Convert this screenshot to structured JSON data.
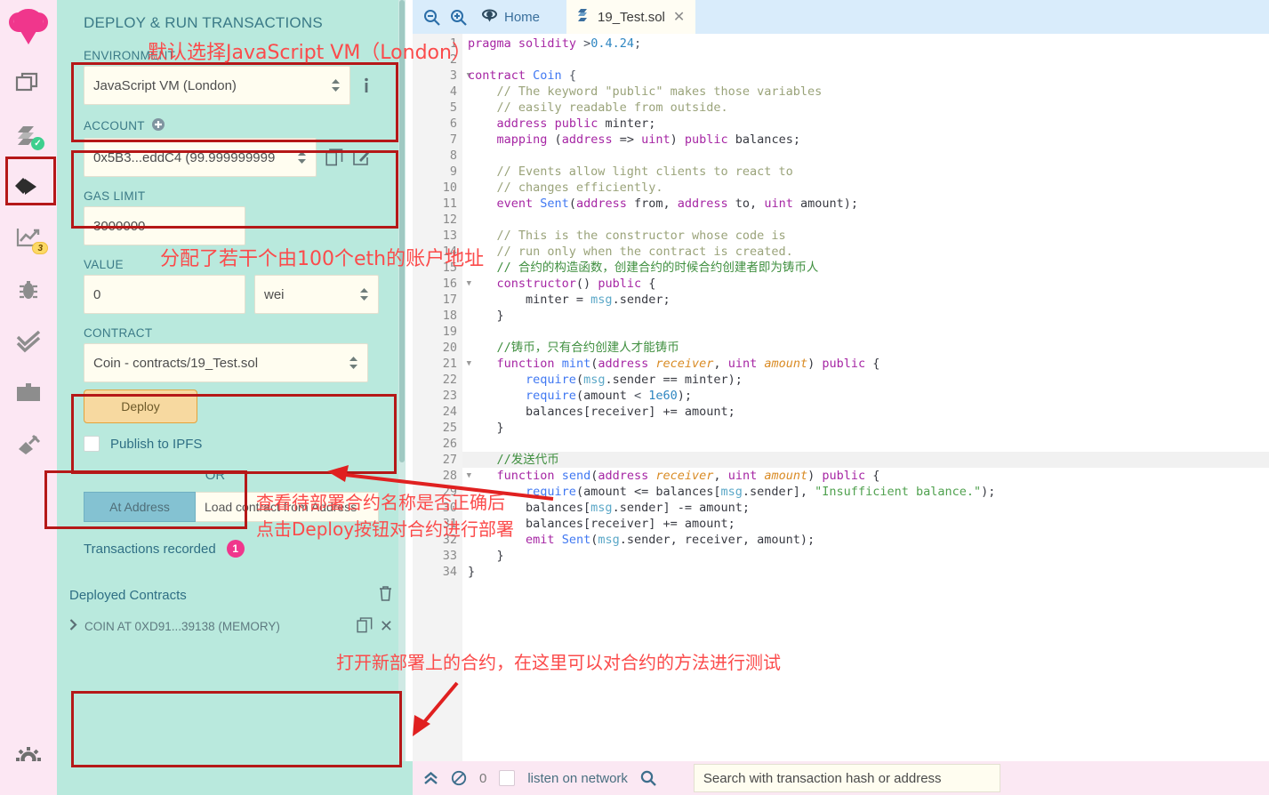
{
  "iconbar": {
    "items": [
      {
        "name": "remix-logo",
        "label": "Remix"
      },
      {
        "name": "file-explorer",
        "label": "File explorers"
      },
      {
        "name": "solidity-compiler",
        "label": "Solidity compiler",
        "status": "compiled"
      },
      {
        "name": "deploy-run-transactions",
        "label": "Deploy & run transactions",
        "selected": true
      },
      {
        "name": "solidity-analyzers",
        "label": "Solidity analyzers",
        "badge": "3"
      },
      {
        "name": "debugger",
        "label": "Debugger"
      },
      {
        "name": "solidity-unit-testing",
        "label": "Solidity unit testing"
      },
      {
        "name": "documentation",
        "label": "Documentation"
      },
      {
        "name": "plugin-manager",
        "label": "Plugin manager"
      },
      {
        "name": "settings",
        "label": "Settings"
      }
    ]
  },
  "panel": {
    "title": "DEPLOY & RUN TRANSACTIONS",
    "environment": {
      "label": "ENVIRONMENT",
      "value": "JavaScript VM (London)"
    },
    "account": {
      "label": "ACCOUNT",
      "value": "0x5B3...eddC4 (99.999999999"
    },
    "gas_limit": {
      "label": "GAS LIMIT",
      "value": "3000000"
    },
    "value": {
      "label": "VALUE",
      "value": "0",
      "unit": "wei"
    },
    "contract": {
      "label": "CONTRACT",
      "value": "Coin - contracts/19_Test.sol"
    },
    "deploy_button": "Deploy",
    "publish_ipfs": "Publish to IPFS",
    "or": "OR",
    "at_address_button": "At Address",
    "at_address_placeholder": "Load contract from Address",
    "transactions_recorded": {
      "label": "Transactions recorded",
      "count": "1"
    },
    "deployed_contracts": {
      "title": "Deployed Contracts",
      "items": [
        "COIN AT 0XD91...39138 (MEMORY)"
      ]
    }
  },
  "annotations": [
    "默认选择JavaScript VM（London）",
    "分配了若干个由100个eth的账户地址",
    "查看待部署合约名称是否正确后",
    "点击Deploy按钮对合约进行部署",
    "打开新部署上的合约，在这里可以对合约的方法进行测试"
  ],
  "editor": {
    "tabs": [
      {
        "name": "home",
        "label": "Home"
      },
      {
        "name": "file",
        "label": "19_Test.sol",
        "active": true
      }
    ],
    "highlight_line": 27,
    "lines": [
      {
        "n": 1,
        "fold": false,
        "tokens": [
          [
            "kw",
            "pragma"
          ],
          [
            "id",
            " "
          ],
          [
            "kw",
            "solidity"
          ],
          [
            "id",
            " "
          ],
          [
            "op",
            ">"
          ],
          [
            "nu",
            "0.4.24"
          ],
          [
            "op",
            ";"
          ]
        ]
      },
      {
        "n": 2,
        "fold": false,
        "tokens": [
          [
            "id",
            ""
          ]
        ]
      },
      {
        "n": 3,
        "fold": true,
        "tokens": [
          [
            "kw",
            "contract"
          ],
          [
            "id",
            " "
          ],
          [
            "fn",
            "Coin"
          ],
          [
            "id",
            " "
          ],
          [
            "op",
            "{"
          ]
        ]
      },
      {
        "n": 4,
        "fold": false,
        "tokens": [
          [
            "cm",
            "    // The keyword \"public\" makes those variables"
          ]
        ]
      },
      {
        "n": 5,
        "fold": false,
        "tokens": [
          [
            "cm",
            "    // easily readable from outside."
          ]
        ]
      },
      {
        "n": 6,
        "fold": false,
        "tokens": [
          [
            "id",
            "    "
          ],
          [
            "kw",
            "address"
          ],
          [
            "id",
            " "
          ],
          [
            "kw",
            "public"
          ],
          [
            "id",
            " minter;"
          ]
        ]
      },
      {
        "n": 7,
        "fold": false,
        "tokens": [
          [
            "id",
            "    "
          ],
          [
            "kw",
            "mapping"
          ],
          [
            "id",
            " ("
          ],
          [
            "kw",
            "address"
          ],
          [
            "id",
            " => "
          ],
          [
            "kw",
            "uint"
          ],
          [
            "id",
            ") "
          ],
          [
            "kw",
            "public"
          ],
          [
            "id",
            " balances;"
          ]
        ]
      },
      {
        "n": 8,
        "fold": false,
        "tokens": [
          [
            "id",
            ""
          ]
        ]
      },
      {
        "n": 9,
        "fold": false,
        "tokens": [
          [
            "cm",
            "    // Events allow light clients to react to"
          ]
        ]
      },
      {
        "n": 10,
        "fold": false,
        "tokens": [
          [
            "cm",
            "    // changes efficiently."
          ]
        ]
      },
      {
        "n": 11,
        "fold": false,
        "tokens": [
          [
            "id",
            "    "
          ],
          [
            "kw",
            "event"
          ],
          [
            "id",
            " "
          ],
          [
            "fn",
            "Sent"
          ],
          [
            "id",
            "("
          ],
          [
            "kw",
            "address"
          ],
          [
            "id",
            " from, "
          ],
          [
            "kw",
            "address"
          ],
          [
            "id",
            " to, "
          ],
          [
            "kw",
            "uint"
          ],
          [
            "id",
            " amount);"
          ]
        ]
      },
      {
        "n": 12,
        "fold": false,
        "tokens": [
          [
            "id",
            ""
          ]
        ]
      },
      {
        "n": 13,
        "fold": false,
        "tokens": [
          [
            "cm",
            "    // This is the constructor whose code is"
          ]
        ]
      },
      {
        "n": 14,
        "fold": false,
        "tokens": [
          [
            "cm",
            "    // run only when the contract is created."
          ]
        ]
      },
      {
        "n": 15,
        "fold": false,
        "tokens": [
          [
            "cmg",
            "    // 合约的构造函数，创建合约的时候合约创建者即为铸币人"
          ]
        ]
      },
      {
        "n": 16,
        "fold": true,
        "tokens": [
          [
            "id",
            "    "
          ],
          [
            "kw",
            "constructor"
          ],
          [
            "id",
            "() "
          ],
          [
            "kw",
            "public"
          ],
          [
            "id",
            " {"
          ]
        ]
      },
      {
        "n": 17,
        "fold": false,
        "tokens": [
          [
            "id",
            "        minter = "
          ],
          [
            "obj",
            "msg"
          ],
          [
            "id",
            ".sender;"
          ]
        ]
      },
      {
        "n": 18,
        "fold": false,
        "tokens": [
          [
            "id",
            "    }"
          ]
        ]
      },
      {
        "n": 19,
        "fold": false,
        "tokens": [
          [
            "id",
            ""
          ]
        ]
      },
      {
        "n": 20,
        "fold": false,
        "tokens": [
          [
            "cmg",
            "    //铸币，只有合约创建人才能铸币"
          ]
        ]
      },
      {
        "n": 21,
        "fold": true,
        "tokens": [
          [
            "id",
            "    "
          ],
          [
            "kw",
            "function"
          ],
          [
            "id",
            " "
          ],
          [
            "fn",
            "mint"
          ],
          [
            "id",
            "("
          ],
          [
            "kw",
            "address"
          ],
          [
            "id",
            " "
          ],
          [
            "par",
            "receiver"
          ],
          [
            "id",
            ", "
          ],
          [
            "kw",
            "uint"
          ],
          [
            "id",
            " "
          ],
          [
            "par",
            "amount"
          ],
          [
            "id",
            ") "
          ],
          [
            "kw",
            "public"
          ],
          [
            "id",
            " {"
          ]
        ]
      },
      {
        "n": 22,
        "fold": false,
        "tokens": [
          [
            "id",
            "        "
          ],
          [
            "fn",
            "require"
          ],
          [
            "id",
            "("
          ],
          [
            "obj",
            "msg"
          ],
          [
            "id",
            ".sender == minter);"
          ]
        ]
      },
      {
        "n": 23,
        "fold": false,
        "tokens": [
          [
            "id",
            "        "
          ],
          [
            "fn",
            "require"
          ],
          [
            "id",
            "(amount "
          ],
          [
            "op",
            "<"
          ],
          [
            "id",
            " "
          ],
          [
            "nu",
            "1e60"
          ],
          [
            "id",
            ");"
          ]
        ]
      },
      {
        "n": 24,
        "fold": false,
        "tokens": [
          [
            "id",
            "        balances[receiver] += amount;"
          ]
        ]
      },
      {
        "n": 25,
        "fold": false,
        "tokens": [
          [
            "id",
            "    }"
          ]
        ]
      },
      {
        "n": 26,
        "fold": false,
        "tokens": [
          [
            "id",
            ""
          ]
        ]
      },
      {
        "n": 27,
        "fold": false,
        "tokens": [
          [
            "cmg",
            "    //发送代币"
          ]
        ]
      },
      {
        "n": 28,
        "fold": true,
        "tokens": [
          [
            "id",
            "    "
          ],
          [
            "kw",
            "function"
          ],
          [
            "id",
            " "
          ],
          [
            "fn",
            "send"
          ],
          [
            "id",
            "("
          ],
          [
            "kw",
            "address"
          ],
          [
            "id",
            " "
          ],
          [
            "par",
            "receiver"
          ],
          [
            "id",
            ", "
          ],
          [
            "kw",
            "uint"
          ],
          [
            "id",
            " "
          ],
          [
            "par",
            "amount"
          ],
          [
            "id",
            ") "
          ],
          [
            "kw",
            "public"
          ],
          [
            "id",
            " {"
          ]
        ]
      },
      {
        "n": 29,
        "fold": false,
        "tokens": [
          [
            "id",
            "        "
          ],
          [
            "fn",
            "require"
          ],
          [
            "id",
            "(amount <= balances["
          ],
          [
            "obj",
            "msg"
          ],
          [
            "id",
            ".sender], "
          ],
          [
            "st",
            "\"Insufficient balance.\""
          ],
          [
            "id",
            ");"
          ]
        ]
      },
      {
        "n": 30,
        "fold": false,
        "tokens": [
          [
            "id",
            "        balances["
          ],
          [
            "obj",
            "msg"
          ],
          [
            "id",
            ".sender] -= amount;"
          ]
        ]
      },
      {
        "n": 31,
        "fold": false,
        "tokens": [
          [
            "id",
            "        balances[receiver] += amount;"
          ]
        ]
      },
      {
        "n": 32,
        "fold": false,
        "tokens": [
          [
            "id",
            "        "
          ],
          [
            "kw",
            "emit"
          ],
          [
            "id",
            " "
          ],
          [
            "fn",
            "Sent"
          ],
          [
            "id",
            "("
          ],
          [
            "obj",
            "msg"
          ],
          [
            "id",
            ".sender, receiver, amount);"
          ]
        ]
      },
      {
        "n": 33,
        "fold": false,
        "tokens": [
          [
            "id",
            "    }"
          ]
        ]
      },
      {
        "n": 34,
        "fold": false,
        "tokens": [
          [
            "id",
            "}"
          ]
        ]
      }
    ]
  },
  "terminal": {
    "pending_count": "0",
    "listen_label": "listen on network",
    "search_placeholder": "Search with transaction hash or address"
  },
  "colors": {
    "panel_bg": "#b9e9dd",
    "iconbar_bg": "#fce7f3",
    "accent_pink": "#f0368c",
    "annotation_red": "#fb4b4b",
    "redbox": "#b51818",
    "deploy_btn": "#f7d9a0",
    "at_address_btn": "#84c2d2",
    "tabbar_bg": "#d9ecfb",
    "terminal_bg": "#fbe8f3"
  }
}
